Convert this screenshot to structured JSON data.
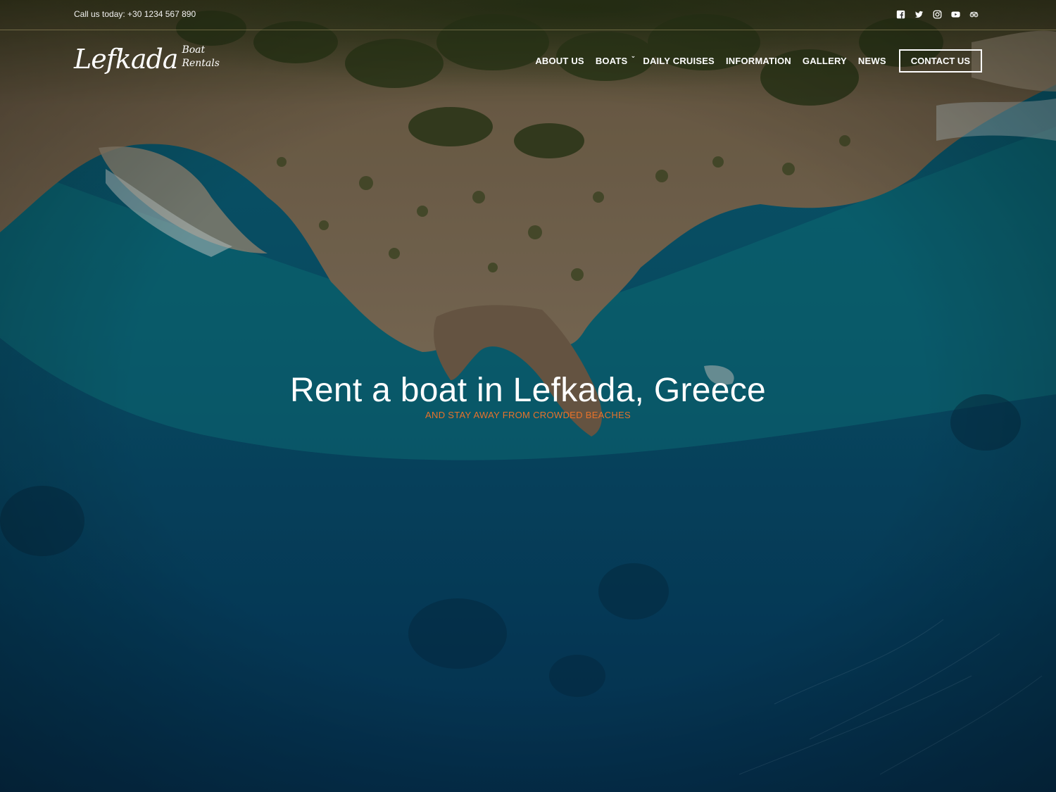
{
  "topbar": {
    "phone": "Call us today: +30 1234 567 890",
    "socials": [
      "facebook-icon",
      "twitter-icon",
      "instagram-icon",
      "youtube-icon",
      "tripadvisor-icon"
    ]
  },
  "logo": {
    "main": "Lefkada",
    "sub_line1": "Boat",
    "sub_line2": "Rentals"
  },
  "nav": {
    "items": [
      {
        "label": "ABOUT US"
      },
      {
        "label": "BOATS"
      },
      {
        "label": "DAILY CRUISES"
      },
      {
        "label": "INFORMATION"
      },
      {
        "label": "GALLERY"
      },
      {
        "label": "NEWS"
      }
    ],
    "contact_label": "CONTACT US"
  },
  "hero": {
    "title": "Rent a boat in Lefkada, Greece",
    "subtitle": "AND STAY AWAY FROM CROWDED BEACHES"
  },
  "colors": {
    "accent": "#e8722a",
    "sea": "#0a5a78",
    "deep_sea": "#073553",
    "rock": "#8e7a5e",
    "vegetation": "#3c4a24"
  }
}
